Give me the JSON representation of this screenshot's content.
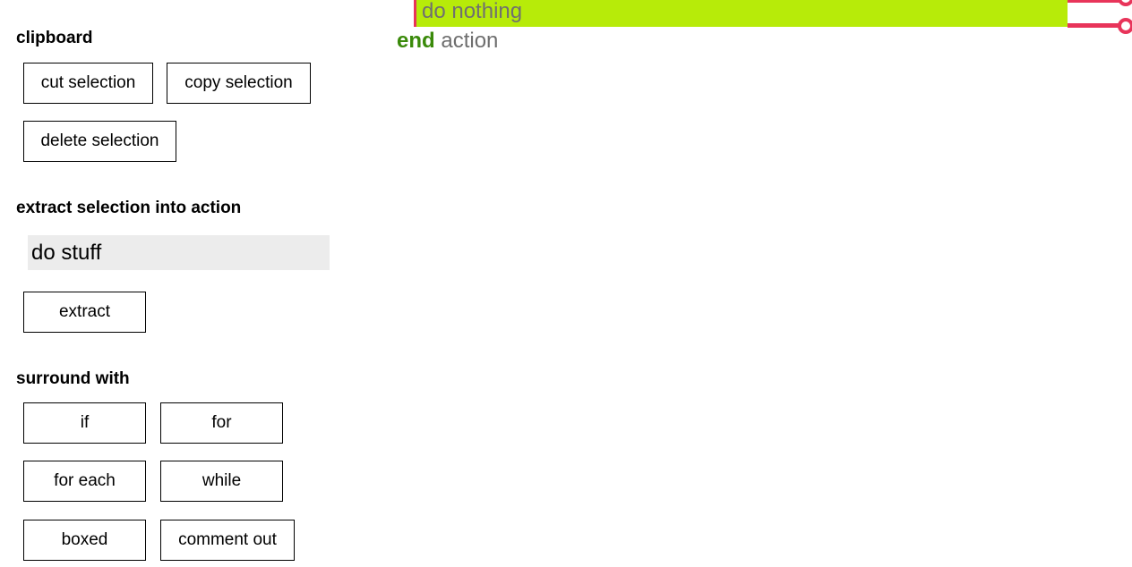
{
  "clipboard": {
    "heading": "clipboard",
    "cut_label": "cut selection",
    "copy_label": "copy selection",
    "delete_label": "delete selection"
  },
  "extract": {
    "heading": "extract selection into action",
    "input_value": "do stuff",
    "button_label": "extract"
  },
  "surround": {
    "heading": "surround with",
    "if_label": "if",
    "for_label": "for",
    "for_each_label": "for each",
    "while_label": "while",
    "boxed_label": "boxed",
    "comment_out_label": "comment out"
  },
  "code": {
    "statement_text": "do nothing",
    "end_keyword": "end",
    "end_target": "action"
  },
  "colors": {
    "statement_highlight": "#b7eb09",
    "selection_handle": "#e8345a",
    "end_keyword": "#3a8a0a",
    "muted_text": "#6e6e6e"
  }
}
